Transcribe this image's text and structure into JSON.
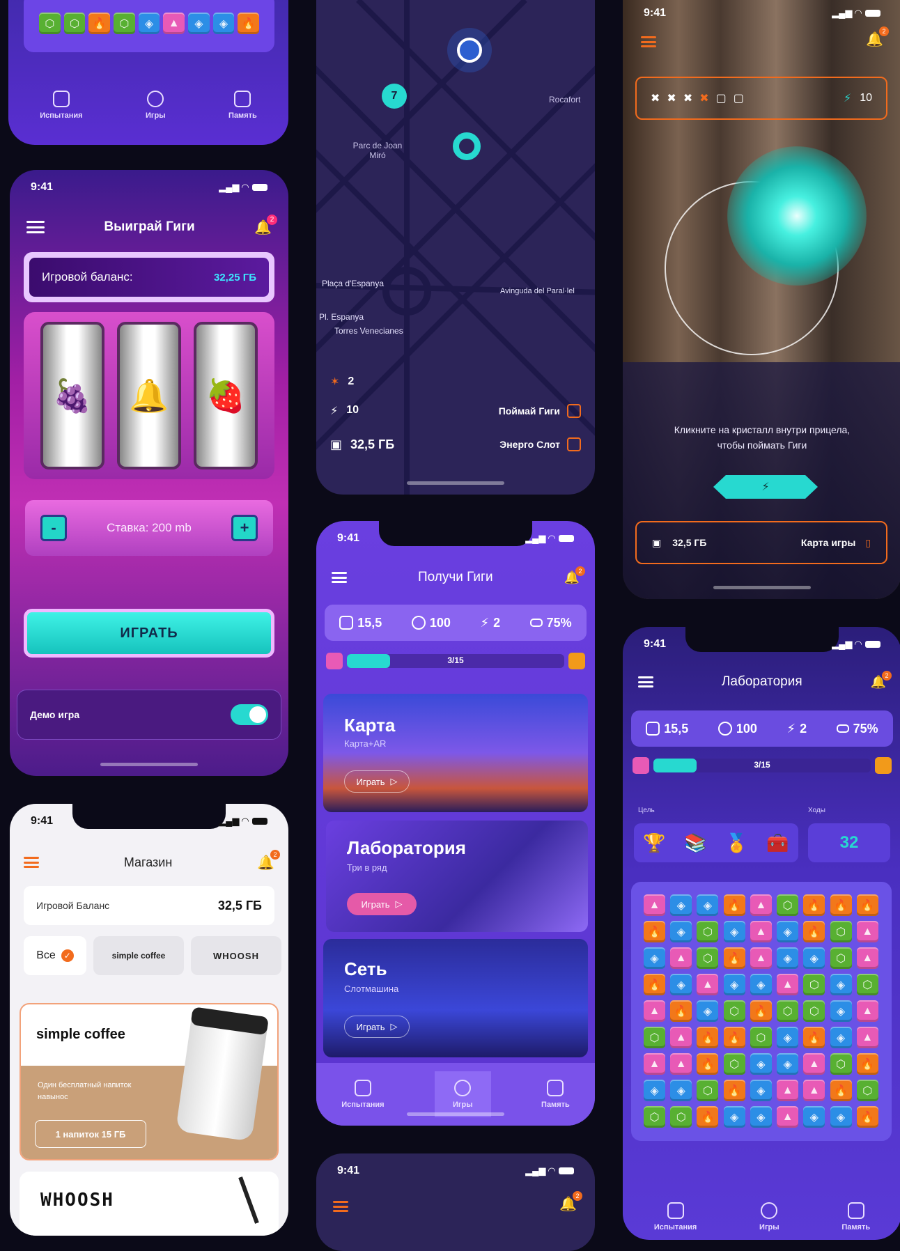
{
  "status_time": "9:41",
  "p1": {
    "nav": [
      "Испытания",
      "Игры",
      "Память"
    ]
  },
  "slot": {
    "title": "Выиграй Гиги",
    "balance_label": "Игровой баланс:",
    "balance_value": "32,25 ГБ",
    "stake_label": "Ставка: 200 mb",
    "minus": "-",
    "plus": "+",
    "play": "ИГРАТЬ",
    "demo_label": "Демо игра",
    "notif_count": "2",
    "fruits": [
      "🍇",
      "🔔",
      "🍓"
    ]
  },
  "shop": {
    "title": "Магазин",
    "balance_label": "Игровой Баланс",
    "balance_value": "32,5 ГБ",
    "filters": [
      "Все",
      "simple coffee",
      "WHOOSH"
    ],
    "promo_brand": "simple coffee",
    "promo_desc": "Один бесплатный напиток навынос",
    "promo_price": "1 напиток 15 ГБ",
    "brand2": "WHOOSH",
    "notif_count": "2"
  },
  "map": {
    "labels": [
      "Parc de Joan Miró",
      "Plaça d'Espanya",
      "Pl. Espanya",
      "Torres Venecianes",
      "Rocafort",
      "Avinguda del Paral·lel"
    ],
    "cluster": "7",
    "stars": "2",
    "energy": "10",
    "data": "32,5 ГБ",
    "catch": "Поймай Гиги",
    "energy_slot": "Энерго Слот"
  },
  "games": {
    "title": "Получи Гиги",
    "stats": [
      "15,5",
      "100",
      "2",
      "75%"
    ],
    "progress": "3/15",
    "progress_fraction": 0.2,
    "notif_count": "2",
    "cards": [
      {
        "title": "Карта",
        "sub": "Карта+AR",
        "btn": "Играть"
      },
      {
        "title": "Лаборатория",
        "sub": "Три в ряд",
        "btn": "Играть"
      },
      {
        "title": "Сеть",
        "sub": "Слотмашина",
        "btn": "Играть"
      }
    ],
    "nav": [
      "Испытания",
      "Игры",
      "Память"
    ]
  },
  "ar": {
    "hint": "Кликните на кристалл внутри прицела, чтобы поймать Гиги",
    "energy": "10",
    "data": "32,5 ГБ",
    "map_link": "Карта игры",
    "notif_count": "2"
  },
  "lab": {
    "title": "Лаборатория",
    "stats": [
      "15,5",
      "100",
      "2",
      "75%"
    ],
    "progress": "3/15",
    "progress_fraction": 0.2,
    "goal_label": "Цель",
    "moves_label": "Ходы",
    "moves": "32",
    "notif_count": "2",
    "nav": [
      "Испытания",
      "Игры",
      "Память"
    ]
  },
  "bottom": {
    "notif_count": "2"
  },
  "colors": {
    "accent_teal": "#27d9d0",
    "purple": "#5b34d6",
    "orange": "#f26b1d",
    "pink": "#d83ab3"
  },
  "grid": [
    "pbbopgooo",
    "obgbpbogp",
    "bpgopbbgp",
    "obpbbpgbg",
    "pobgoggbp",
    "gpoogbobp",
    "ppogbbpgo",
    "bbgobppog",
    "ggobbpbbo"
  ]
}
